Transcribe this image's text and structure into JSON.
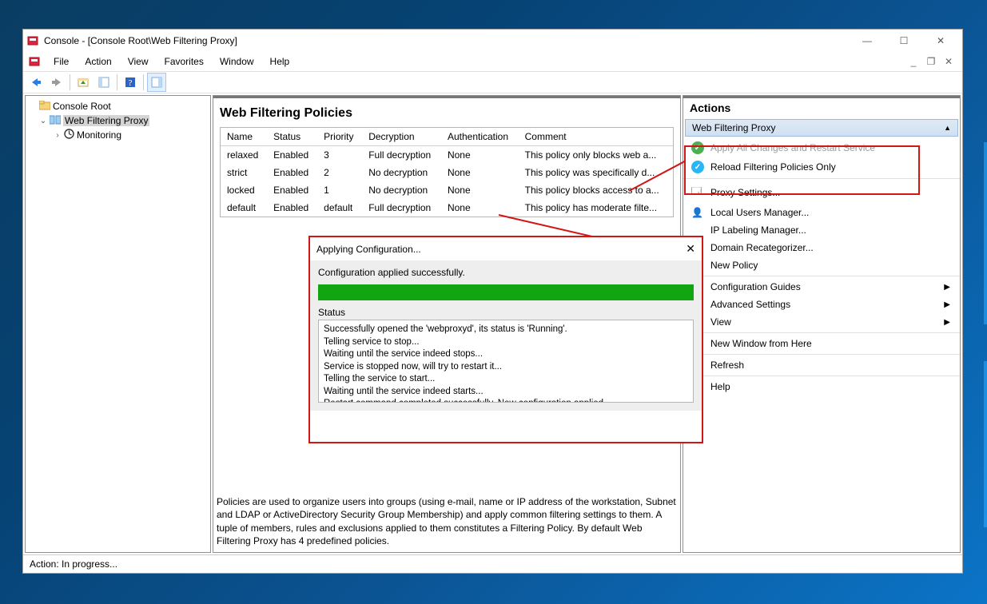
{
  "window": {
    "title": "Console - [Console Root\\Web Filtering Proxy]"
  },
  "menus": [
    "File",
    "Action",
    "View",
    "Favorites",
    "Window",
    "Help"
  ],
  "tree": {
    "root": "Console Root",
    "node1": "Web Filtering Proxy",
    "node2": "Monitoring"
  },
  "center": {
    "title": "Web Filtering Policies",
    "headers": [
      "Name",
      "Status",
      "Priority",
      "Decryption",
      "Authentication",
      "Comment"
    ],
    "rows": [
      {
        "c0": "relaxed",
        "c1": "Enabled",
        "c2": "3",
        "c3": "Full decryption",
        "c4": "None",
        "c5": "This policy only blocks web a..."
      },
      {
        "c0": "strict",
        "c1": "Enabled",
        "c2": "2",
        "c3": "No decryption",
        "c4": "None",
        "c5": "This policy was specifically d..."
      },
      {
        "c0": "locked",
        "c1": "Enabled",
        "c2": "1",
        "c3": "No decryption",
        "c4": "None",
        "c5": "This policy blocks access to a..."
      },
      {
        "c0": "default",
        "c1": "Enabled",
        "c2": "default",
        "c3": "Full decryption",
        "c4": "None",
        "c5": "This policy has moderate filte..."
      }
    ],
    "description": "Policies are used to organize users into groups (using e-mail, name or IP address of the workstation, Subnet and LDAP or ActiveDirectory Security Group Membership) and apply common filtering settings to them. A tuple of members, rules and exclusions applied to them constitutes a Filtering Policy. By default Web Filtering Proxy has 4 predefined policies."
  },
  "actions": {
    "title": "Actions",
    "subtitle": "Web Filtering Proxy",
    "items": [
      {
        "label": "Apply All Changes and Restart Service",
        "disabled": true
      },
      {
        "label": "Reload Filtering Policies Only"
      },
      {
        "label": "Proxy Settings..."
      },
      {
        "label": "Local Users Manager..."
      },
      {
        "label": "IP Labeling Manager..."
      },
      {
        "label": "Domain Recategorizer..."
      },
      {
        "label": "New Policy"
      },
      {
        "label": "Configuration Guides",
        "sub": true
      },
      {
        "label": "Advanced Settings",
        "sub": true
      },
      {
        "label": "View",
        "sub": true
      },
      {
        "label": "New Window from Here"
      },
      {
        "label": "Refresh"
      },
      {
        "label": "Help"
      }
    ]
  },
  "dialog": {
    "title": "Applying Configuration...",
    "message": "Configuration applied successfully.",
    "status_label": "Status",
    "log": "Successfully opened the 'webproxyd', its status is 'Running'.\nTelling service to stop...\nWaiting until the service indeed stops...\nService is stopped now, will try to restart it...\nTelling the service to start...\nWaiting until the service indeed starts...\nRestart command completed successfully. New configuration applied."
  },
  "status": {
    "prefix": "Action:",
    "text": "In progress..."
  }
}
